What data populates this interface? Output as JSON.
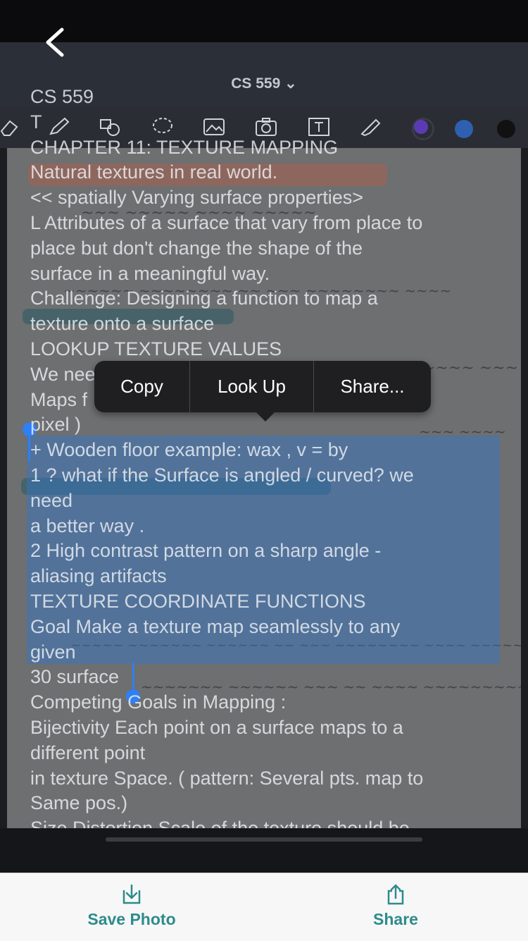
{
  "header": {
    "back_icon": "chevron-left-icon",
    "notebook_title": "CS 559 ⌄"
  },
  "toolbar": {
    "tools": [
      "eraser-icon",
      "pencil-icon",
      "shapes-icon",
      "lasso-icon",
      "image-icon",
      "camera-icon",
      "text-box-icon",
      "highlighter-icon"
    ],
    "colors": [
      "#5b3bb3",
      "#2f5fb0",
      "#111111"
    ]
  },
  "ocr_lines": [
    "CS 559",
    "T",
    "CHAPTER 11: TEXTURE MAPPING",
    "Natural textures in real world.",
    "<< spatially Varying surface properties>",
    "L Attributes of a surface that vary from place to",
    "place but don't change the shape of the",
    "surface in a meaningful way.",
    "Challenge: Designing a function to map a",
    "texture onto a surface",
    "LOOKUP TEXTURE VALUES",
    "We nee",
    "Maps f                                              every",
    "pixel )",
    "+ Wooden floor example: wax , v = by",
    "1 ? what if the Surface is angled / curved? we",
    "need",
    "a better way .",
    "2 High contrast pattern on a sharp angle -",
    "aliasing artifacts",
    "TEXTURE COORDINATE FUNCTIONS",
    "Goal Make a texture map seamlessly to any",
    "given",
    "30 surface",
    "Competing Goals in Mapping :",
    "Bijectivity Each point on a surface maps to a",
    "different point",
    "in texture Space. ( pattern: Several pts. map to",
    "Same pos.)",
    "Size Distortion Scale of the texture should be"
  ],
  "callout_menu": {
    "items": [
      "Copy",
      "Look Up",
      "Share..."
    ]
  },
  "bottom_bar": {
    "save_label": "Save Photo",
    "save_icon": "download-tray-icon",
    "share_label": "Share",
    "share_icon": "share-icon",
    "accent": "#2e8b8b"
  }
}
